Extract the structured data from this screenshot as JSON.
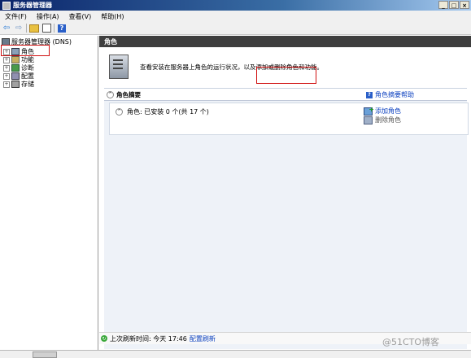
{
  "window": {
    "title": "服务器管理器",
    "controls": {
      "minimize": "_",
      "maximize": "□",
      "close": "×"
    }
  },
  "menu": {
    "items": [
      "文件(F)",
      "操作(A)",
      "查看(V)",
      "帮助(H)"
    ]
  },
  "toolbar": {
    "icons": [
      "back-arrow-icon",
      "forward-arrow-icon",
      "folder-icon",
      "grid-view-icon",
      "help-icon"
    ],
    "back_glyph": "⇦",
    "forward_glyph": "⇨",
    "help_glyph": "?"
  },
  "tree": {
    "root_label": "服务器管理器 (DNS)",
    "nodes": [
      {
        "label": "角色",
        "icon": "roles-icon",
        "selected": true
      },
      {
        "label": "功能",
        "icon": "features-icon"
      },
      {
        "label": "诊断",
        "icon": "diagnostics-icon"
      },
      {
        "label": "配置",
        "icon": "configuration-icon"
      },
      {
        "label": "存储",
        "icon": "storage-icon"
      }
    ],
    "expander_glyph": "+"
  },
  "content": {
    "header": "角色",
    "description": "查看安装在服务器上角色的运行状况，以及添加或删除角色和功能。",
    "section": {
      "title": "角色摘要",
      "collapse_glyph": "^",
      "help_link": "角色摘要帮助",
      "help_glyph": "?",
      "status": "角色: 已安装 0 个(共 17 个)",
      "add_roles": "添加角色",
      "remove_roles": "删除角色"
    },
    "status_bar": {
      "last_refresh": "上次刷新时间: 今天 17:46",
      "configure_refresh": "配置刷新"
    }
  },
  "watermark": "@51CTO博客",
  "colors": {
    "accent_link": "#0a3fbf",
    "highlight_box": "#d01010",
    "header_bar": "#3e3e3e"
  }
}
